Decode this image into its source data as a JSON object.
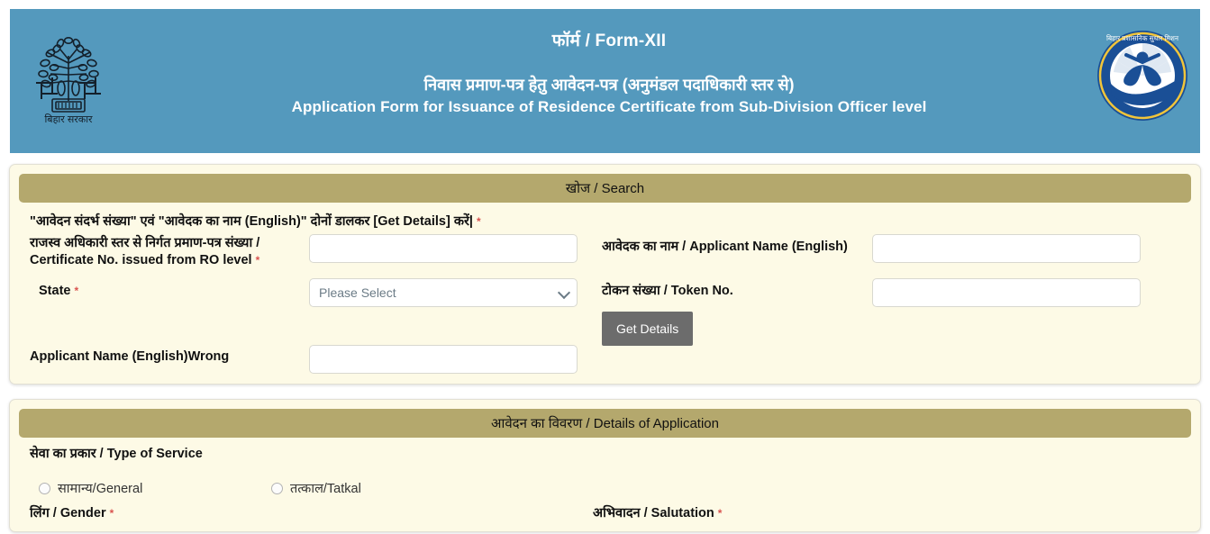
{
  "header": {
    "form_no": "फॉर्म / Form-XII",
    "title_hi": "निवास प्रमाण-पत्र हेतु आवेदन-पत्र (अनुमंडल पदाधिकारी स्तर से)",
    "title_en": "Application Form for Issuance of Residence Certificate from  Sub-Division Officer level",
    "left_emblem_caption": "बिहार सरकार",
    "left_emblem_name": "bihar-government-emblem",
    "right_logo_text": "बिहार प्रशासनिक सुधार मिशन",
    "right_logo_name": "bihar-administrative-reforms-mission-logo",
    "banner_color": "#5499bd"
  },
  "search": {
    "section_title": "खोज / Search",
    "note": "\"आवेदन संदर्भ संख्या\" एवं \"आवेदक का नाम (English)\" दोनों डालकर [Get Details] करें|",
    "note_required": "*",
    "cert_no": {
      "label_line1": "राजस्व अधिकारी स्तर से निर्गत प्रमाण-पत्र संख्या /",
      "label_line2": "Certificate No. issued from RO level",
      "required": "*",
      "value": "",
      "placeholder": ""
    },
    "applicant_name": {
      "label": "आवेदक का नाम / Applicant Name (English)",
      "value": "",
      "placeholder": ""
    },
    "state": {
      "label": "State",
      "required": "*",
      "selected": "Please Select",
      "options": [
        "Please Select"
      ]
    },
    "token_no": {
      "label": "टोकन संख्या / Token No.",
      "value": "",
      "placeholder": ""
    },
    "get_details_label": "Get Details",
    "applicant_name_wrong": {
      "label": "Applicant Name (English)Wrong",
      "value": "",
      "placeholder": ""
    }
  },
  "details": {
    "section_title": "आवेदन का विवरण / Details of Application",
    "type_of_service": {
      "label": "सेवा का प्रकार / Type of Service",
      "options": [
        {
          "label": "सामान्य/General",
          "checked": false
        },
        {
          "label": "तत्काल/Tatkal",
          "checked": false
        }
      ]
    },
    "gender": {
      "label": "लिंग / Gender",
      "required": "*"
    },
    "salutation": {
      "label": "अभिवादन / Salutation",
      "required": "*"
    }
  },
  "colors": {
    "banner": "#5499bd",
    "panel_bg": "#fdfae6",
    "section_bar": "#b4a86d",
    "button": "#6c6c6c",
    "required_asterisk": "#d9534f"
  }
}
